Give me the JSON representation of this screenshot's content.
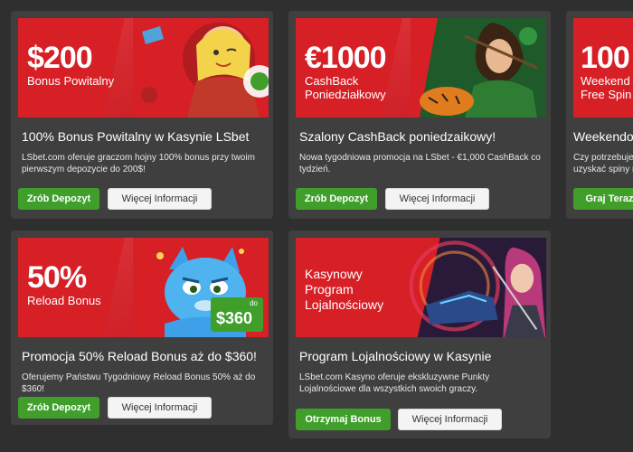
{
  "cards": [
    {
      "amount": "$200",
      "subtitle": "Bonus Powitalny",
      "title": "100% Bonus Powitalny w Kasynie LSbet",
      "description": "LSbet.com oferuje graczom hojny 100% bonus przy twoim pierwszym depozycie do 200$!",
      "primary_button": "Zrób Depozyt",
      "secondary_button": "Więcej Informacji"
    },
    {
      "amount": "€1000",
      "subtitle": "CashBack Poniedziałkowy",
      "title": "Szalony CashBack poniedzaikowy!",
      "description": "Nowa tygodniowa promocja na LSbet - €1,000 CashBack co tydzień.",
      "primary_button": "Zrób Depozyt",
      "secondary_button": "Więcej Informacji"
    },
    {
      "amount": "100",
      "subtitle": "Weekend Free Spin",
      "title": "Weekendow",
      "description": "Czy potrzebuje uzyskać spiny n",
      "primary_button": "Graj Teraz"
    },
    {
      "amount": "50%",
      "subtitle": "Reload Bonus",
      "badge_prefix": "do",
      "badge_value": "$360",
      "title": "Promocja 50% Reload Bonus aż do $360!",
      "description": "Oferujemy Państwu Tygodniowy Reload Bonus 50% aż do $360!",
      "primary_button": "Zrób Depozyt",
      "secondary_button": "Więcej Informacji"
    },
    {
      "subtitle": "Kasynowy Program Lojalnościowy",
      "title": "Program Lojalnościowy w Kasynie",
      "description": "LSbet.com Kasyno oferuje ekskluzywne Punkty Lojalnościowe dla wszystkich swoich graczy.",
      "primary_button": "Otrzymaj Bonus",
      "secondary_button": "Więcej Informacji"
    }
  ],
  "colors": {
    "background": "#2f2f2f",
    "card": "#3f3f3f",
    "banner_red": "#d71f26",
    "button_green": "#3f9f2a"
  }
}
